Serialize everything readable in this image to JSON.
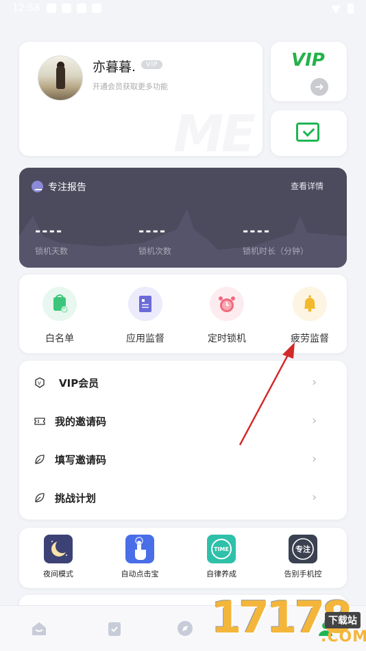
{
  "status_bar": {
    "time": "12:58",
    "battery": "0"
  },
  "profile": {
    "username": "亦暮暮.",
    "vip_badge": "VIP",
    "subtitle": "开通会员获取更多功能",
    "watermark": "ME"
  },
  "side_cards": {
    "vip_label": "VIP",
    "arrow_icon": "arrow-right-icon",
    "message_icon": "mail-icon"
  },
  "report": {
    "title": "专注报告",
    "detail_link": "查看详情",
    "stats": [
      {
        "value": "----",
        "label": "锁机天数"
      },
      {
        "value": "----",
        "label": "锁机次数"
      },
      {
        "value": "----",
        "label": "锁机时长（分钟）"
      }
    ]
  },
  "features": [
    {
      "label": "白名单",
      "icon": "whitelist-bag-icon",
      "bg": "#e8f7ef",
      "color": "#3cc67a"
    },
    {
      "label": "应用监督",
      "icon": "app-monitor-icon",
      "bg": "#ecebfb",
      "color": "#6b6ad9"
    },
    {
      "label": "定时锁机",
      "icon": "alarm-clock-icon",
      "bg": "#fdecef",
      "color": "#f06a7d"
    },
    {
      "label": "疲劳监督",
      "icon": "bell-icon",
      "bg": "#fdf4e2",
      "color": "#f3b92c"
    }
  ],
  "menu": [
    {
      "label": "VIP会员",
      "icon": "vip-shield-icon"
    },
    {
      "label": "我的邀请码",
      "icon": "ticket-icon"
    },
    {
      "label": "填写邀请码",
      "icon": "leaf-icon"
    },
    {
      "label": "挑战计划",
      "icon": "leaf-icon"
    }
  ],
  "tools": [
    {
      "label": "夜间模式",
      "icon": "moon-icon",
      "bg": "#3c4275"
    },
    {
      "label": "自动点击宝",
      "icon": "tap-hand-icon",
      "bg": "#4a6ee8"
    },
    {
      "label": "自律养成",
      "icon": "time-badge-icon",
      "bg": "#2fc0a9",
      "inner_text": "TIME"
    },
    {
      "label": "告别手机控",
      "icon": "goodbye-phone-icon",
      "bg": "#3a4150",
      "inner_text": "专注"
    }
  ],
  "site_watermark": {
    "digits": "17178",
    "badge": "下载站",
    "domain": ".COM"
  }
}
